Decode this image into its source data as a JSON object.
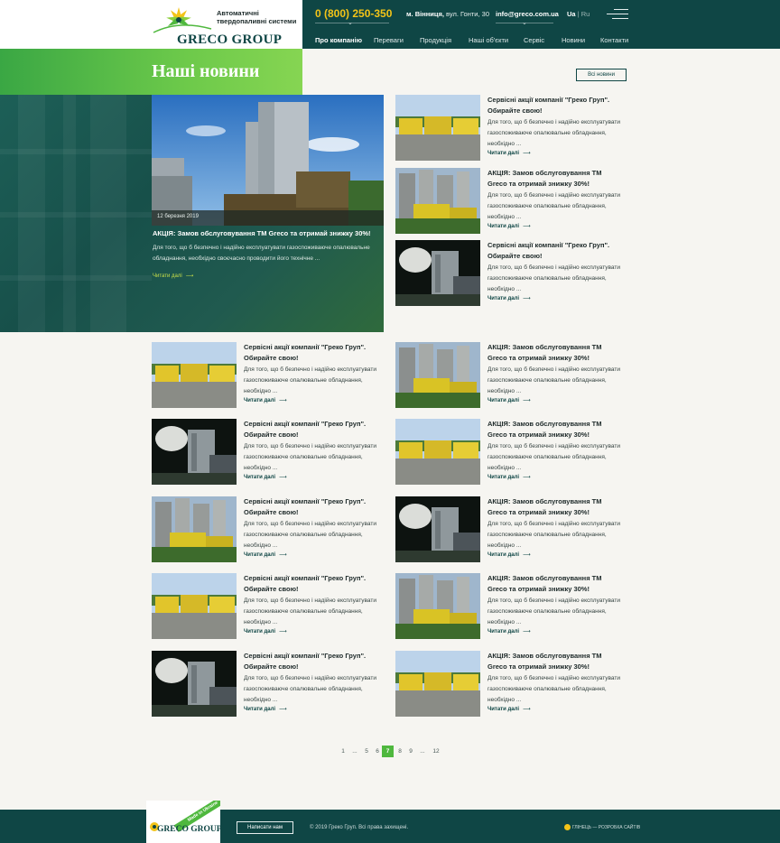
{
  "header": {
    "logo_tagline": "Автоматичні твердопаливні системи",
    "logo_name": "GRECO GROUP",
    "phone": "0 (800) 250-350",
    "city": "м. Вінниця,",
    "street": " вул. Гонти, 30",
    "email": "info@greco.com.ua",
    "lang_active": "Ua",
    "lang_sep": "|",
    "lang_other": "Ru",
    "nav": [
      "Про компанію",
      "Переваги",
      "Продукція",
      "Наші об'єкти",
      "Сервіс",
      "Новини",
      "Контакти"
    ]
  },
  "hero": {
    "title": "Наші новини",
    "all_news": "Всі новини",
    "date": "12 березня 2019",
    "card_title": "АКЦІЯ: Замов обслуговування ТМ Greco та отримай знижку 30%!",
    "card_text": "Для того, що б безпечно і надійно експлуатувати газоспоживаюче опалювальне обладнання, необхідно своєчасно проводити його технічне ...",
    "read_more": "Читати далі"
  },
  "news": [
    {
      "title": "Сервісні акції компанії \"Греко Груп\". Обирайте свою!",
      "text": "Для того, що б безпечно і надійно експлуатувати газоспоживаюче опалювальне обладнання, необхідно ...",
      "more": "Читати далі",
      "img": "trucks"
    },
    {
      "title": "АКЦІЯ: Замов обслуговування ТМ Greco та отримай знижку 30%!",
      "text": "Для того, що б безпечно і надійно експлуатувати газоспоживаюче опалювальне обладнання, необхідно ...",
      "more": "Читати далі",
      "img": "silos"
    },
    {
      "title": "Сервісні акції компанії \"Греко Груп\". Обирайте свою!",
      "text": "Для того, що б безпечно і надійно експлуатувати газоспоживаюче опалювальне обладнання, необхідно ...",
      "more": "Читати далі",
      "img": "night"
    },
    {
      "title": "Сервісні акції компанії \"Греко Груп\". Обирайте свою!",
      "text": "Для того, що б безпечно і надійно експлуатувати газоспоживаюче опалювальне обладнання, необхідно ...",
      "more": "Читати далі",
      "img": "trucks"
    },
    {
      "title": "АКЦІЯ: Замов обслуговування ТМ Greco та отримай знижку 30%!",
      "text": "Для того, що б безпечно і надійно експлуатувати газоспоживаюче опалювальне обладнання, необхідно ...",
      "more": "Читати далі",
      "img": "silos"
    },
    {
      "title": "Сервісні акції компанії \"Греко Груп\". Обирайте свою!",
      "text": "Для того, що б безпечно і надійно експлуатувати газоспоживаюче опалювальне обладнання, необхідно ...",
      "more": "Читати далі",
      "img": "night"
    },
    {
      "title": "АКЦІЯ: Замов обслуговування ТМ Greco та отримай знижку 30%!",
      "text": "Для того, що б безпечно і надійно експлуатувати газоспоживаюче опалювальне обладнання, необхідно ...",
      "more": "Читати далі",
      "img": "trucks"
    },
    {
      "title": "Сервісні акції компанії \"Греко Груп\". Обирайте свою!",
      "text": "Для того, що б безпечно і надійно експлуатувати газоспоживаюче опалювальне обладнання, необхідно ...",
      "more": "Читати далі",
      "img": "silos"
    },
    {
      "title": "АКЦІЯ: Замов обслуговування ТМ Greco та отримай знижку 30%!",
      "text": "Для того, що б безпечно і надійно експлуатувати газоспоживаюче опалювальне обладнання, необхідно ...",
      "more": "Читати далі",
      "img": "night"
    },
    {
      "title": "Сервісні акції компанії \"Греко Груп\". Обирайте свою!",
      "text": "Для того, що б безпечно і надійно експлуатувати газоспоживаюче опалювальне обладнання, необхідно ...",
      "more": "Читати далі",
      "img": "trucks"
    },
    {
      "title": "АКЦІЯ: Замов обслуговування ТМ Greco та отримай знижку 30%!",
      "text": "Для того, що б безпечно і надійно експлуатувати газоспоживаюче опалювальне обладнання, необхідно ...",
      "more": "Читати далі",
      "img": "silos"
    },
    {
      "title": "Сервісні акції компанії \"Греко Груп\". Обирайте свою!",
      "text": "Для того, що б безпечно і надійно експлуатувати газоспоживаюче опалювальне обладнання, необхідно ...",
      "more": "Читати далі",
      "img": "night"
    },
    {
      "title": "АКЦІЯ: Замов обслуговування ТМ Greco та отримай знижку 30%!",
      "text": "Для того, що б безпечно і надійно експлуатувати газоспоживаюче опалювальне обладнання, необхідно ...",
      "more": "Читати далі",
      "img": "trucks"
    }
  ],
  "pagination": [
    "1",
    "...",
    "5",
    "6",
    "7",
    "8",
    "9",
    "...",
    "12"
  ],
  "pagination_current": "7",
  "footer": {
    "logo_ribbon": "Made in Ukraine",
    "logo_name": "GRECO GROUP",
    "write_us": "Написати нам",
    "copyright": "© 2019 Греко Груп. Всі права захищені.",
    "developer": "ГЛІНЕЦЬ — РОЗРОБКА САЙТІВ"
  },
  "colors": {
    "brand_dark": "#0f4645",
    "brand_green": "#4fb83e",
    "accent_yellow": "#f3c418"
  }
}
